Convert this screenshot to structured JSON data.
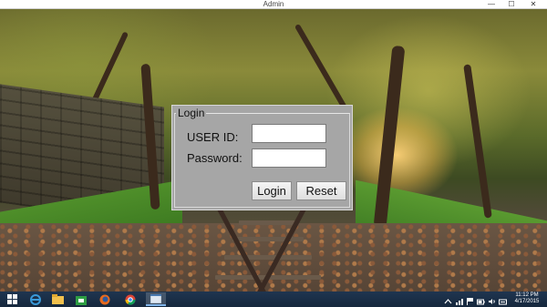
{
  "window": {
    "title": "Admin",
    "minimize_glyph": "—",
    "maximize_glyph": "☐",
    "close_glyph": "✕"
  },
  "login": {
    "group_title": "Login",
    "user_id_label": "USER ID:",
    "password_label": "Password:",
    "user_id_value": "",
    "password_value": "",
    "login_button": "Login",
    "reset_button": "Reset"
  },
  "taskbar": {
    "items": [
      {
        "icon": "windows-start-icon"
      },
      {
        "icon": "internet-explorer-icon"
      },
      {
        "icon": "file-explorer-icon"
      },
      {
        "icon": "store-icon"
      },
      {
        "icon": "firefox-icon"
      },
      {
        "icon": "chrome-icon"
      },
      {
        "icon": "app-window-icon",
        "active": true
      }
    ],
    "tray_icons": [
      "chevron-up-icon",
      "network-icon",
      "flag-icon",
      "battery-icon",
      "volume-icon",
      "keyboard-icon"
    ],
    "clock_time": "11:12 PM",
    "clock_date": "4/17/2015"
  },
  "colors": {
    "dialog_bg": "#a6a6a6",
    "taskbar_bg": "#1f3550",
    "accent": "#7fb3e8"
  }
}
